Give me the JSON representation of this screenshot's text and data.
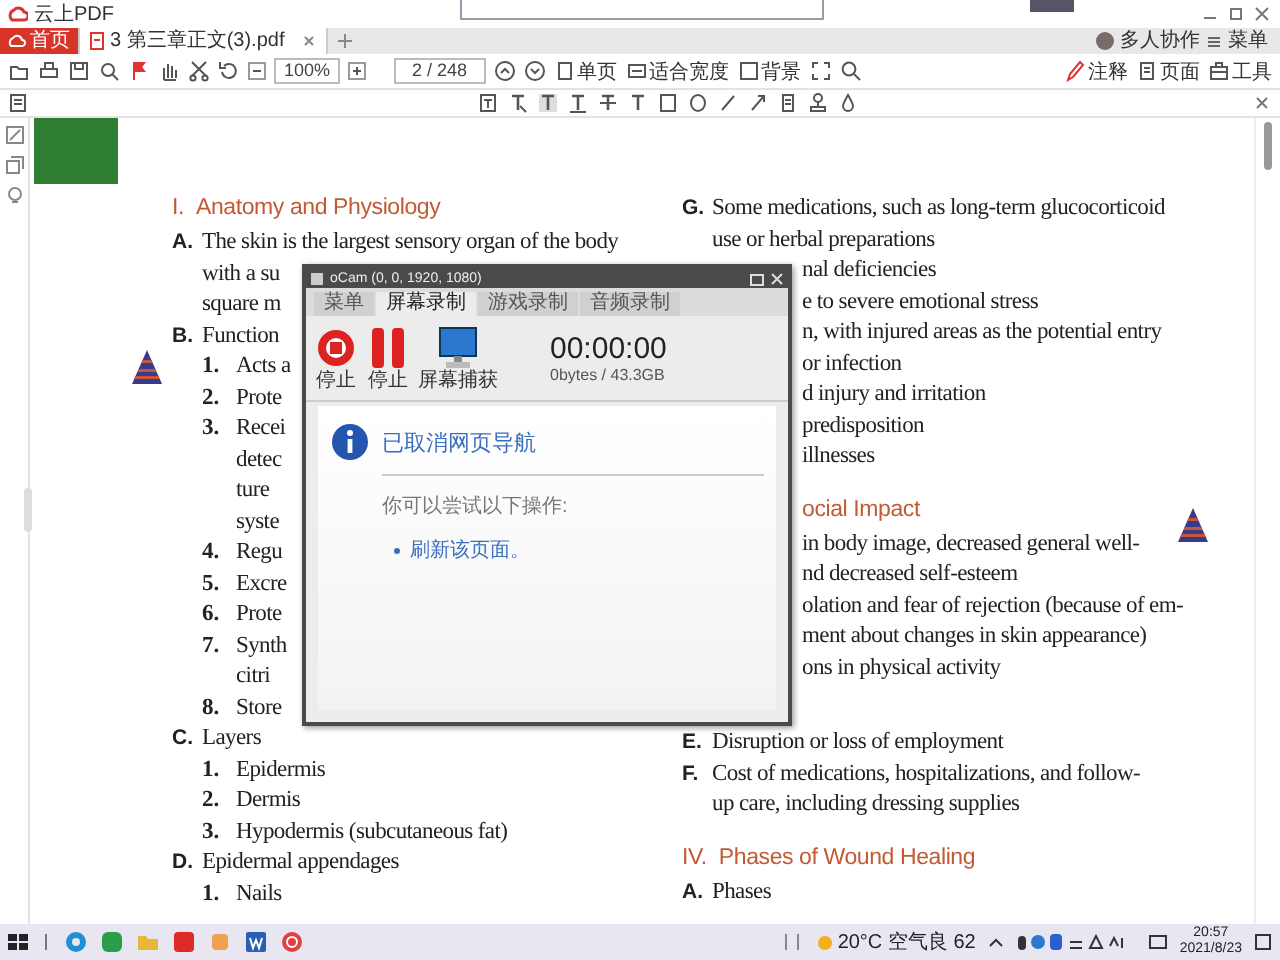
{
  "app": {
    "title": "云上PDF"
  },
  "tabs": [
    {
      "label": "首页",
      "kind": "home",
      "selected": false
    },
    {
      "label": "3 第三章正文(3).pdf",
      "kind": "file",
      "selected": true
    }
  ],
  "tab_bar_right": {
    "collab": "多人协作",
    "menu": "菜单"
  },
  "toolbar": {
    "zoom": "100%",
    "page": "2 / 248",
    "view_buttons": [
      "单页",
      "适合宽度",
      "背景"
    ],
    "right_buttons": [
      "注释",
      "页面",
      "工具"
    ]
  },
  "document": {
    "left": [
      {
        "kind": "heading",
        "marker": "I.",
        "text": "Anatomy and Physiology"
      },
      {
        "kind": "letter",
        "marker": "A.",
        "text": "The skin is the largest sensory organ of the body"
      },
      {
        "kind": "cont",
        "text": "with a su"
      },
      {
        "kind": "cont",
        "text": "square m"
      },
      {
        "kind": "letter",
        "marker": "B.",
        "text": "Function"
      },
      {
        "kind": "number",
        "marker": "1.",
        "text": "Acts a"
      },
      {
        "kind": "number",
        "marker": "2.",
        "text": "Prote"
      },
      {
        "kind": "number",
        "marker": "3.",
        "text": "Recei"
      },
      {
        "kind": "subcont",
        "text": "detec"
      },
      {
        "kind": "subcont",
        "text": "ture"
      },
      {
        "kind": "subcont",
        "text": "syste"
      },
      {
        "kind": "number",
        "marker": "4.",
        "text": "Regu"
      },
      {
        "kind": "number",
        "marker": "5.",
        "text": "Excre"
      },
      {
        "kind": "number",
        "marker": "6.",
        "text": "Prote"
      },
      {
        "kind": "number",
        "marker": "7.",
        "text": "Synth"
      },
      {
        "kind": "subcont",
        "text": "citri"
      },
      {
        "kind": "number",
        "marker": "8.",
        "text": "Store"
      },
      {
        "kind": "letter",
        "marker": "C.",
        "text": "Layers"
      },
      {
        "kind": "number",
        "marker": "1.",
        "text": "Epidermis"
      },
      {
        "kind": "number",
        "marker": "2.",
        "text": "Dermis"
      },
      {
        "kind": "number",
        "marker": "3.",
        "text": "Hypodermis (subcutaneous fat)"
      },
      {
        "kind": "letter",
        "marker": "D.",
        "text": "Epidermal appendages"
      },
      {
        "kind": "number",
        "marker": "1.",
        "text": "Nails"
      }
    ],
    "right": [
      {
        "kind": "letter",
        "marker": "G.",
        "text": "Some medications, such as long-term glucocorticoid"
      },
      {
        "kind": "cont",
        "text": "use or herbal preparations"
      },
      {
        "kind": "cont",
        "text": "nal deficiencies",
        "clipped": true
      },
      {
        "kind": "cont",
        "text": "e to severe emotional stress",
        "clipped": true
      },
      {
        "kind": "cont",
        "text": "n, with injured areas as the potential entry",
        "clipped": true
      },
      {
        "kind": "cont",
        "text": "or infection",
        "clipped": true
      },
      {
        "kind": "cont",
        "text": "d injury and irritation",
        "clipped": true
      },
      {
        "kind": "cont",
        "text": "predisposition",
        "clipped": true
      },
      {
        "kind": "cont",
        "text": "illnesses",
        "clipped": true
      },
      {
        "kind": "heading",
        "text": "ocial Impact",
        "clipped": true
      },
      {
        "kind": "cont",
        "text": "in body image, decreased general well-",
        "clipped": true
      },
      {
        "kind": "cont",
        "text": "nd decreased self-esteem",
        "clipped": true
      },
      {
        "kind": "cont",
        "text": "olation and fear of rejection (because of em-",
        "clipped": true
      },
      {
        "kind": "cont",
        "text": "ment about changes in skin appearance)",
        "clipped": true
      },
      {
        "kind": "cont",
        "text": "ons in physical activity",
        "clipped": true
      },
      {
        "kind": "letter",
        "marker": "E.",
        "text": "Disruption or loss of employment"
      },
      {
        "kind": "letter",
        "marker": "F.",
        "text": "Cost of medications, hospitalizations, and follow-"
      },
      {
        "kind": "cont",
        "text": "up care, including dressing supplies"
      },
      {
        "kind": "heading",
        "marker": "IV.",
        "text": "Phases of Wound Healing"
      },
      {
        "kind": "letter",
        "marker": "A.",
        "text": "Phases"
      }
    ]
  },
  "dialog": {
    "title": "oCam (0, 0, 1920, 1080)",
    "tabs": [
      {
        "label": "菜单",
        "selected": false
      },
      {
        "label": "屏幕录制",
        "selected": true
      },
      {
        "label": "游戏录制",
        "selected": false
      },
      {
        "label": "音频录制",
        "selected": false
      }
    ],
    "buttons": [
      {
        "label": "停止",
        "kind": "record"
      },
      {
        "label": "停止",
        "kind": "pause"
      },
      {
        "label": "屏幕捕获",
        "kind": "capture"
      }
    ],
    "time": "00:00:00",
    "storage": "0bytes / 43.3GB",
    "message": "已取消网页导航",
    "hint": "你可以尝试以下操作:",
    "links": [
      "刷新该页面。"
    ]
  },
  "taskbar": {
    "weather": "20°C 空气良 62",
    "time": "20:57",
    "date": "2021/8/23"
  }
}
